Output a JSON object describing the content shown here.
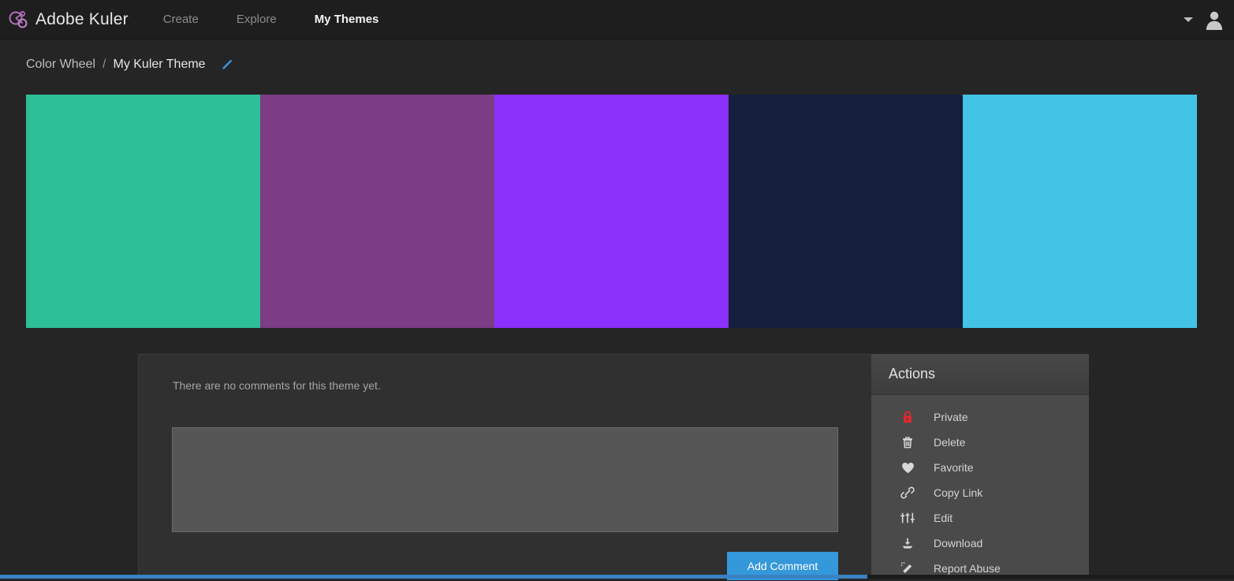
{
  "app": {
    "brand_name": "Adobe Kuler",
    "logo_icon": "kuler-logo-icon"
  },
  "nav": {
    "links": [
      {
        "label": "Create",
        "active": false
      },
      {
        "label": "Explore",
        "active": false
      },
      {
        "label": "My Themes",
        "active": true
      }
    ],
    "account": {
      "caret_icon": "chevron-down-icon",
      "avatar_icon": "user-avatar-icon"
    }
  },
  "breadcrumb": {
    "parent": "Color Wheel",
    "separator": "/",
    "current": "My Kuler Theme",
    "edit_icon": "pencil-icon"
  },
  "theme": {
    "swatches": [
      {
        "hex": "#2dbf95",
        "name": "teal-green-swatch"
      },
      {
        "hex": "#7c3d85",
        "name": "purple-swatch"
      },
      {
        "hex": "#8c30fb",
        "name": "violet-swatch"
      },
      {
        "hex": "#131f3c",
        "name": "dark-navy-swatch"
      },
      {
        "hex": "#41c4e6",
        "name": "sky-blue-swatch"
      }
    ]
  },
  "comments": {
    "empty_message": "There are no comments for this theme yet.",
    "input_value": "",
    "input_placeholder": "",
    "submit_label": "Add Comment"
  },
  "actions": {
    "title": "Actions",
    "items": [
      {
        "label": "Private",
        "icon": "lock-icon",
        "color": "#e8262a"
      },
      {
        "label": "Delete",
        "icon": "trash-icon",
        "color": "#d8d8d8"
      },
      {
        "label": "Favorite",
        "icon": "heart-icon",
        "color": "#d8d8d8"
      },
      {
        "label": "Copy Link",
        "icon": "link-icon",
        "color": "#d8d8d8"
      },
      {
        "label": "Edit",
        "icon": "sliders-icon",
        "color": "#d8d8d8"
      },
      {
        "label": "Download",
        "icon": "download-icon",
        "color": "#d8d8d8"
      },
      {
        "label": "Report Abuse",
        "icon": "eraser-icon",
        "color": "#d8d8d8"
      }
    ]
  },
  "colors": {
    "page_background": "#252525",
    "topnav_background": "#1e1e1e",
    "accent_blue": "#3498db",
    "actions_panel_background": "#4a4a4a"
  }
}
